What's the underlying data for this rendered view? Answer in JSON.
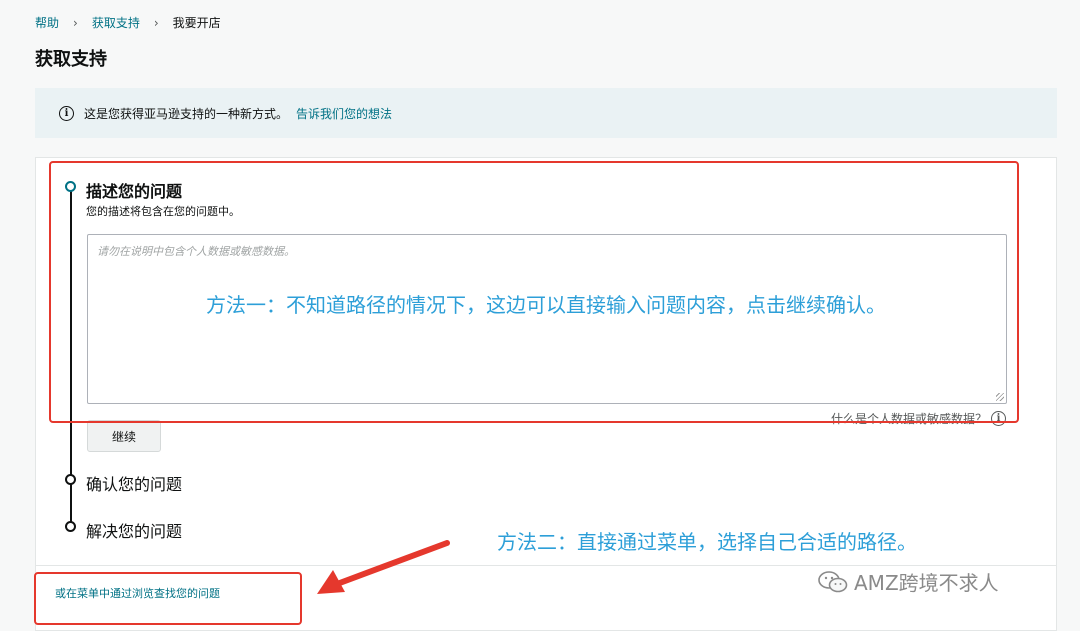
{
  "breadcrumb": {
    "items": [
      "帮助",
      "获取支持",
      "我要开店"
    ],
    "separator": "›"
  },
  "page_title": "获取支持",
  "info_banner": {
    "text": "这是您获得亚马逊支持的一种新方式。",
    "link": "告诉我们您的想法"
  },
  "step1": {
    "title": "描述您的问题",
    "subtitle": "您的描述将包含在您的问题中。",
    "placeholder": "请勿在说明中包含个人数据或敏感数据。",
    "helper": "什么是个人数据或敏感数据？",
    "continue_label": "继续"
  },
  "step2": {
    "label": "确认您的问题"
  },
  "step3": {
    "label": "解决您的问题"
  },
  "browse_link": "或在菜单中通过浏览查找您的问题",
  "annotations": {
    "method1": "方法一：不知道路径的情况下，这边可以直接输入问题内容，点击继续确认。",
    "method2": "方法二：直接通过菜单，选择自己合适的路径。"
  },
  "watermark": "AMZ跨境不求人",
  "colors": {
    "link": "#007185",
    "annotation_box": "#e5382d",
    "annotation_text": "#2d9fd8",
    "banner_bg": "#eaf2f4"
  }
}
